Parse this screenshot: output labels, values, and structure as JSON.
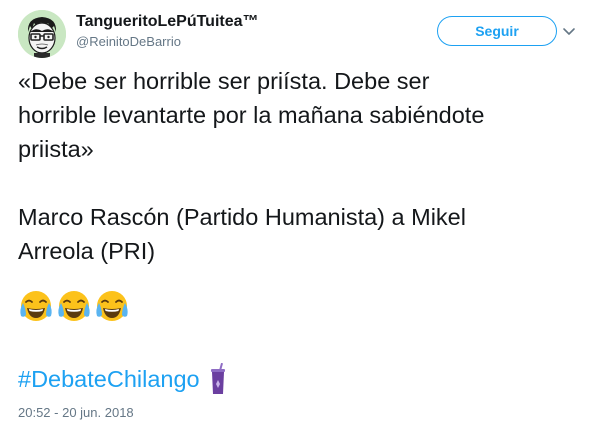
{
  "user": {
    "display_name": "TangueritoLePúTuitea™",
    "handle": "@ReinitoDeBarrio",
    "avatar_icon": "cartoon-face-glasses-avatar"
  },
  "actions": {
    "follow_label": "Seguir",
    "more_icon": "chevron-down-icon"
  },
  "tweet": {
    "lines": [
      "«Debe ser horrible ser priísta. Debe ser",
      "horrible levantarte por la mañana sabiéndote",
      "priista»",
      "",
      "Marco Rascón (Partido Humanista) a Mikel",
      "Arreola (PRI)"
    ],
    "emojis": [
      "face-with-tears-of-joy",
      "face-with-tears-of-joy",
      "face-with-tears-of-joy"
    ],
    "hashtag": "#DebateChilango",
    "hashtag_icon": "purple-cup-icon",
    "timestamp": "20:52 - 20 jun. 2018"
  },
  "colors": {
    "accent": "#1da1f2",
    "text": "#14171a",
    "muted": "#657786",
    "avatar_bg": "#c9e7c2",
    "cup": "#6b3fa0"
  }
}
